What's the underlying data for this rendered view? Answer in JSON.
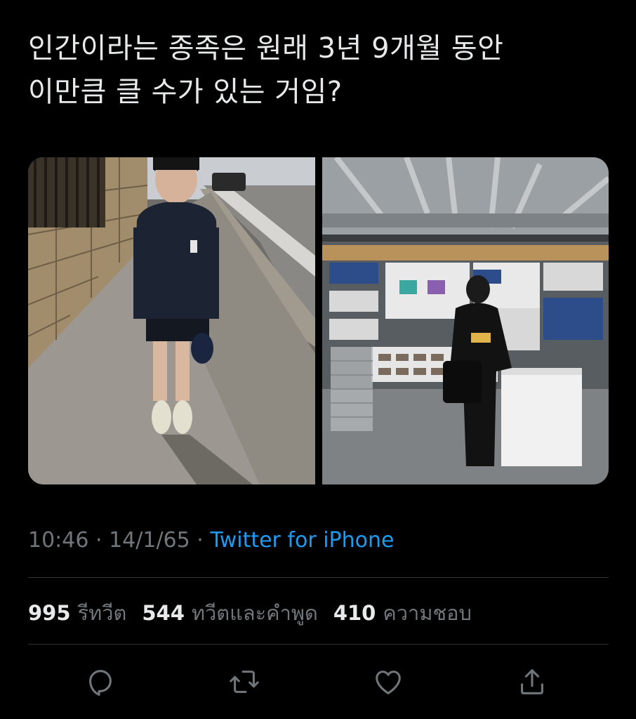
{
  "tweet": {
    "text_lines": [
      "인간이라는 종족은 원래 3년 9개월 동안",
      "이만큼 클 수가 있는 거임?"
    ],
    "time": "10:46",
    "date": "14/1/65",
    "separator": " · ",
    "source": "Twitter for iPhone"
  },
  "media": {
    "images": [
      {
        "subject": "boy-in-school-uniform-on-street"
      },
      {
        "subject": "young-man-in-record-store"
      }
    ]
  },
  "stats": [
    {
      "count": "995",
      "label": "รีทวีต"
    },
    {
      "count": "544",
      "label": "ทวีตและคำพูด"
    },
    {
      "count": "410",
      "label": "ความชอบ"
    }
  ],
  "actions": [
    {
      "icon": "reply-icon"
    },
    {
      "icon": "retweet-icon"
    },
    {
      "icon": "like-icon"
    },
    {
      "icon": "share-icon"
    }
  ],
  "colors": {
    "background": "#000000",
    "text": "#e7e9ea",
    "secondary": "#71767b",
    "link": "#1d9bf0",
    "divider": "#2f3336"
  }
}
